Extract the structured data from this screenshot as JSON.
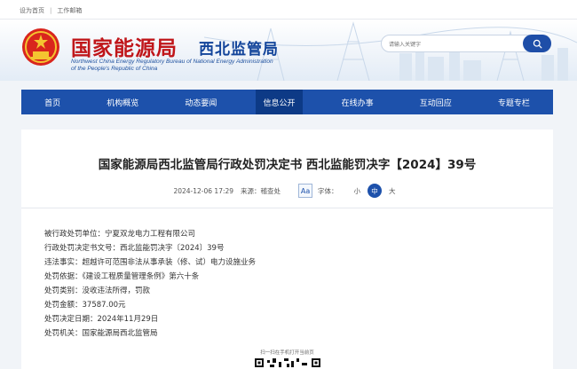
{
  "top_links": {
    "home": "设为首页",
    "sep": "|",
    "mail": "工作邮箱"
  },
  "header": {
    "brand_cn": "国家能源局",
    "brand_sub": "西北监管局",
    "brand_en_line1": "Northwest China Energy Regulatory Bureau of National Energy Administration",
    "brand_en_line2": "of the People's Republic of China"
  },
  "search": {
    "placeholder": "请输入关键字"
  },
  "nav": {
    "items": [
      "首页",
      "机构概览",
      "动态要闻",
      "信息公开",
      "在线办事",
      "互动回应",
      "专题专栏"
    ],
    "active_index": 3
  },
  "article": {
    "title": "国家能源局西北监管局行政处罚决定书 西北监能罚决字【2024】39号",
    "date": "2024-12-06 17:29",
    "source": "来源：稽查处",
    "aa": "Aa",
    "font_label": "字体：",
    "font_small": "小",
    "font_medium": "中",
    "font_large": "大",
    "lines": [
      "被行政处罚单位：宁夏双龙电力工程有限公司",
      "行政处罚决定书文号：西北监能罚决字〔2024〕39号",
      "违法事实：超越许可范围非法从事承装（修、试）电力设施业务",
      "处罚依据：《建设工程质量管理条例》第六十条",
      "处罚类别：没收违法所得，罚款",
      "处罚金额：37587.00元",
      "处罚决定日期：2024年11月29日",
      "处罚机关：国家能源局西北监管局"
    ],
    "qr_caption": "扫一扫在手机打开当前页"
  },
  "colors": {
    "brand_red": "#c0161a",
    "brand_blue": "#12449a",
    "nav_blue": "#1d51ab",
    "nav_active": "#0d3a86"
  },
  "icons": {
    "search": "search-icon",
    "emblem": "national-emblem-icon"
  }
}
